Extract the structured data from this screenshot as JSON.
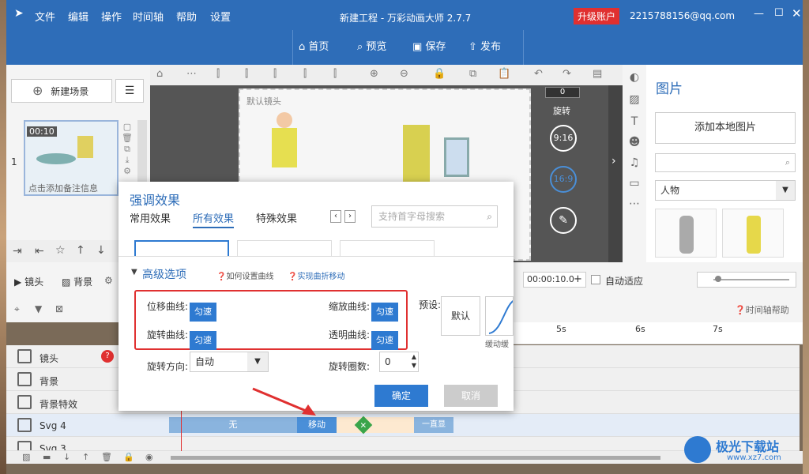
{
  "titlebar": {
    "menus": [
      "文件",
      "编辑",
      "操作",
      "时间轴",
      "帮助",
      "设置"
    ],
    "title": "新建工程 - 万彩动画大师 2.7.7",
    "upgrade": "升级账户",
    "email": "2215788156@qq.com"
  },
  "toolbar": {
    "home": "首页",
    "preview": "预览",
    "save": "保存",
    "publish": "发布"
  },
  "scene": {
    "new_scene": "新建场景",
    "time": "00:10",
    "index": "1",
    "note": "点击添加备注信息"
  },
  "canvas": {
    "camera_label": "默认镜头",
    "rotate_value": "0",
    "rotate_label": "旋转",
    "ratio1": "9:16",
    "ratio2": "16:9"
  },
  "right_panel": {
    "title": "图片",
    "add_local": "添加本地图片",
    "category": "人物"
  },
  "effects": {
    "title": "强调效果",
    "tabs": [
      "常用效果",
      "所有效果",
      "特殊效果"
    ],
    "search_placeholder": "支持首字母搜索"
  },
  "advanced": {
    "title": "高级选项",
    "help1": "如何设置曲线",
    "help2": "实现曲折移动",
    "move_curve": "位移曲线:",
    "rotate_curve": "旋转曲线:",
    "scale_curve": "缩放曲线:",
    "opacity_curve": "透明曲线:",
    "uniform": "匀速",
    "preset": "预设:",
    "default": "默认",
    "ease_label": "缓动缓",
    "rotate_dir": "旋转方向:",
    "rotate_dir_value": "自动",
    "rotate_turns": "旋转圈数:",
    "rotate_turns_value": "0",
    "ok": "确定",
    "cancel": "取消"
  },
  "timeline": {
    "camera_btn": "镜头",
    "bg_btn": "背景",
    "time_value": "00:00:10.0",
    "auto_fit": "自动适应",
    "help": "时间轴帮助",
    "ticks": [
      "5s",
      "6s",
      "7s"
    ],
    "rows": [
      "镜头",
      "背景",
      "背景特效",
      "Svg 4",
      "Svg 3"
    ],
    "bar_none": "无",
    "bar_move": "移动",
    "bar_show": "一直显",
    "bar_show2": "一直显"
  },
  "watermark": {
    "text": "极光下载站",
    "url": "www.xz7.com"
  },
  "colors": {
    "brand": "#2e6db8",
    "accent": "#2e7ad1",
    "highlight": "#e03030"
  }
}
